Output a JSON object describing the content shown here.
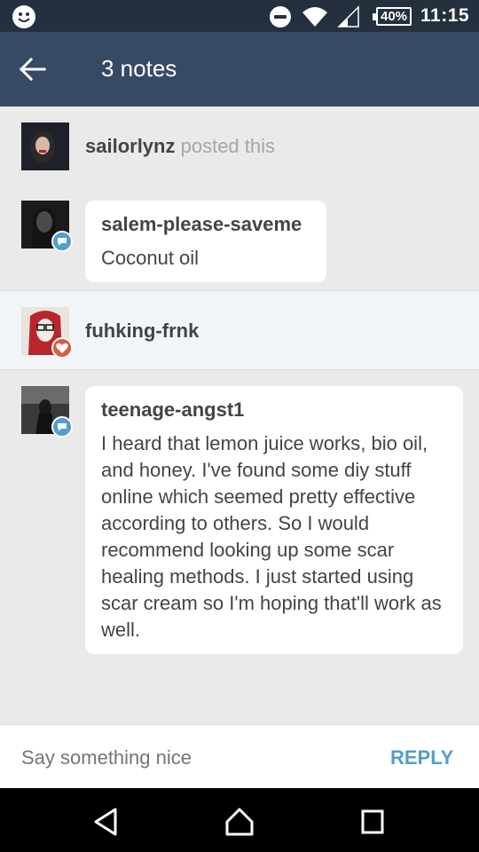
{
  "status_bar": {
    "battery": "40%",
    "time": "11:15"
  },
  "app_bar": {
    "title": "3 notes"
  },
  "notes": [
    {
      "username": "sailorlynz",
      "action": "posted this"
    },
    {
      "username": "salem-please-saveme",
      "text": "Coconut oil",
      "badge": "reply"
    },
    {
      "username": "fuhking-frnk",
      "badge": "like"
    },
    {
      "username": "teenage-angst1",
      "text": "I heard that lemon juice works, bio oil, and honey. I've found some diy stuff online which seemed pretty effective according to others. So I would recommend looking up some scar healing methods. I just started using scar cream so I'm hoping that'll work as well.",
      "badge": "reply"
    }
  ],
  "reply_bar": {
    "placeholder": "Say something nice",
    "button": "REPLY"
  },
  "colors": {
    "status_bar": "#25303f",
    "app_bar": "#374a64",
    "accent": "#529ecc",
    "like": "#d95e40"
  }
}
